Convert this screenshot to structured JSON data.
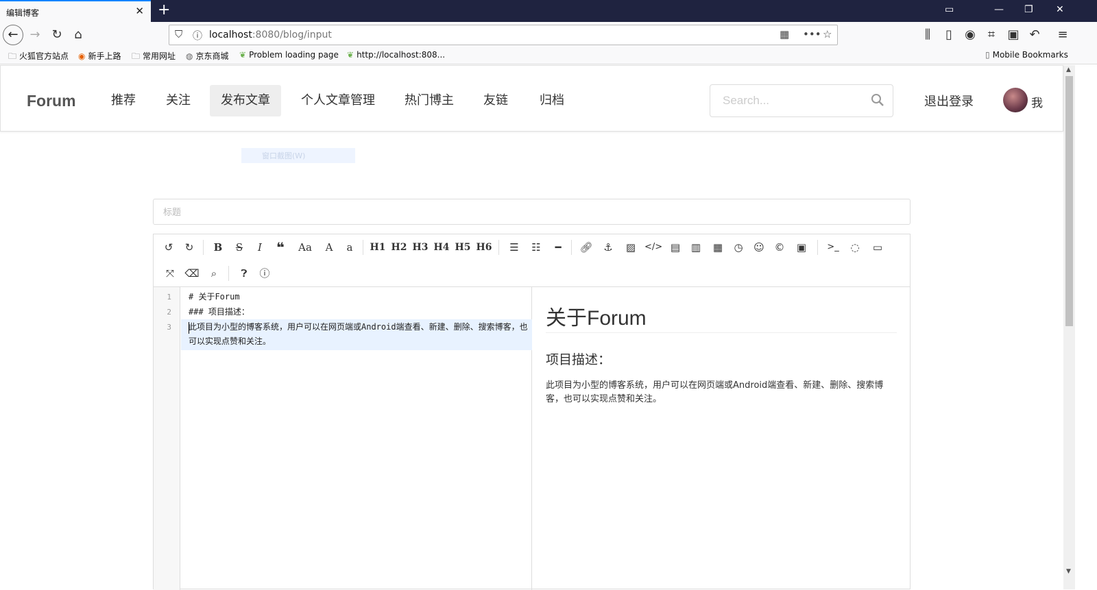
{
  "browser": {
    "tab_title": "编辑博客",
    "tab_close": "✕",
    "new_tab": "+",
    "url_host": "localhost",
    "url_rest": ":8080/blog/input",
    "bookmarks": [
      {
        "icon": "🗀",
        "label": "火狐官方站点"
      },
      {
        "icon": "◉",
        "label": "新手上路"
      },
      {
        "icon": "🗀",
        "label": "常用网址"
      },
      {
        "icon": "◍",
        "label": "京东商城"
      },
      {
        "icon": "❦",
        "label": "Problem loading page"
      },
      {
        "icon": "❦",
        "label": "http://localhost:808..."
      }
    ],
    "mobile_bookmarks": "Mobile Bookmarks"
  },
  "site": {
    "brand": "Forum",
    "menu": [
      {
        "label": "推荐",
        "active": false
      },
      {
        "label": "关注",
        "active": false
      },
      {
        "label": "发布文章",
        "active": true
      },
      {
        "label": "个人文章管理",
        "active": false
      },
      {
        "label": "热门博主",
        "active": false
      },
      {
        "label": "友链",
        "active": false
      },
      {
        "label": "归档",
        "active": false
      }
    ],
    "search_placeholder": "Search...",
    "logout": "退出登录",
    "me": "我"
  },
  "ghost_tooltip": "窗口截图(W)",
  "form": {
    "title_placeholder": "标题"
  },
  "editor": {
    "lines": [
      {
        "num": "1",
        "text": "# 关于Forum"
      },
      {
        "num": "2",
        "text": "### 项目描述："
      },
      {
        "num": "3",
        "text": "此项目为小型的博客系统，用户可以在网页端或Android端查看、新建、删除、搜索博客，也可以实现点赞和关注。"
      }
    ],
    "preview": {
      "h1": "关于Forum",
      "h3": "项目描述：",
      "p": "此项目为小型的博客系统，用户可以在网页端或Android端查看、新建、删除、搜索博客，也可以实现点赞和关注。"
    },
    "toolbar_labels": {
      "bold": "B",
      "italic": "I",
      "font_case": "Aa",
      "upper": "A",
      "lower": "a",
      "h1": "H1",
      "h2": "H2",
      "h3": "H3",
      "h4": "H4",
      "h5": "H5",
      "h6": "H6",
      "terminal": ">_"
    }
  },
  "colors": {
    "accent": "#0a84ff",
    "tabbar": "#1f2340"
  }
}
